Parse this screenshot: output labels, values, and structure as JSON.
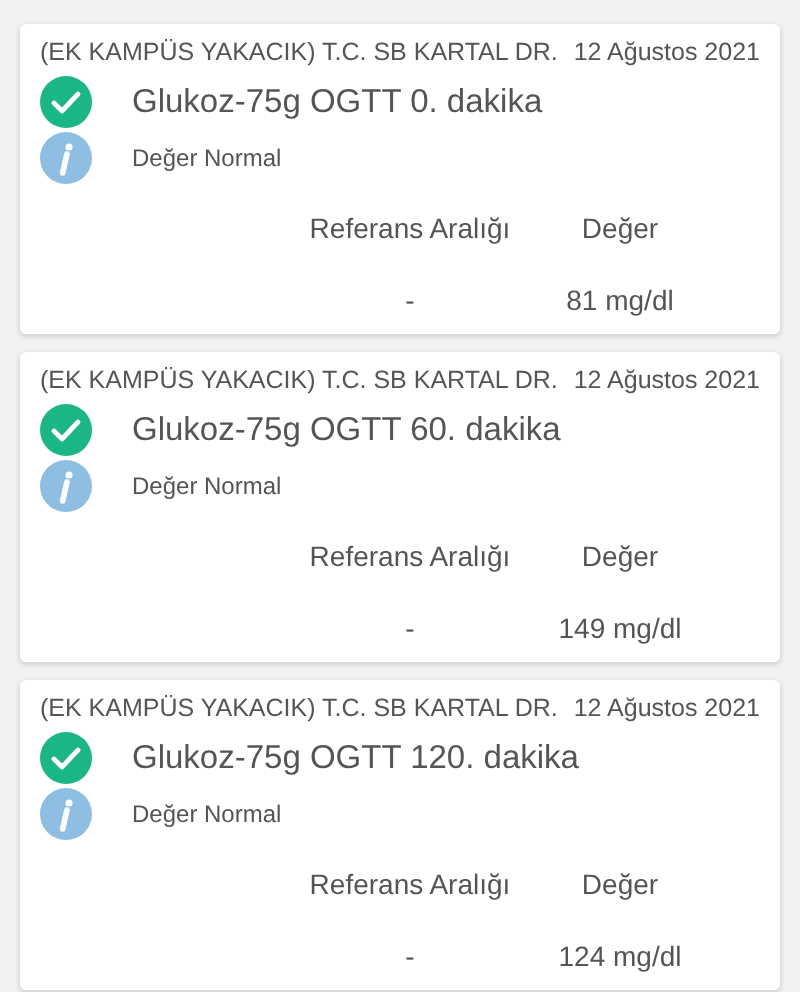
{
  "results": [
    {
      "hospital": "(EK KAMPÜS YAKACIK) T.C. SB KARTAL DR.",
      "date": "12 Ağustos 2021",
      "test": "Glukoz-75g OGTT 0. dakika",
      "note": "Değer Normal",
      "range_label": "Referans Aralığı",
      "value_label": "Değer",
      "range": "-",
      "value": "81 mg/dl"
    },
    {
      "hospital": "(EK KAMPÜS YAKACIK) T.C. SB KARTAL DR.",
      "date": "12 Ağustos 2021",
      "test": "Glukoz-75g OGTT 60. dakika",
      "note": "Değer Normal",
      "range_label": "Referans Aralığı",
      "value_label": "Değer",
      "range": "-",
      "value": "149 mg/dl"
    },
    {
      "hospital": "(EK KAMPÜS YAKACIK) T.C. SB KARTAL DR.",
      "date": "12 Ağustos 2021",
      "test": "Glukoz-75g OGTT 120. dakika",
      "note": "Değer Normal",
      "range_label": "Referans Aralığı",
      "value_label": "Değer",
      "range": "-",
      "value": "124 mg/dl"
    }
  ]
}
